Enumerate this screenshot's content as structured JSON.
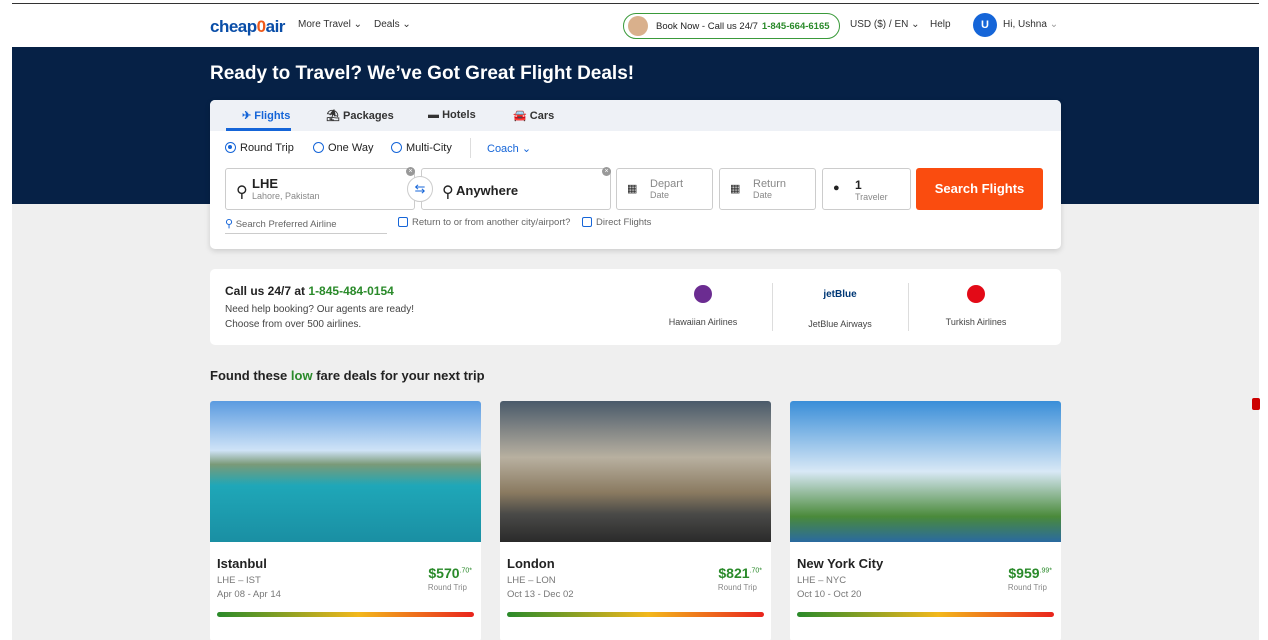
{
  "header": {
    "logo": "cheapOair",
    "more_travel": "More Travel",
    "deals": "Deals",
    "call_label": "Book Now - Call us 24/7",
    "call_phone": "1-845-664-6165",
    "currency": "USD ($) / EN",
    "help": "Help",
    "avatar_initial": "U",
    "greeting": "Hi, Ushna"
  },
  "hero": {
    "title": "Ready to Travel? We’ve Got Great Flight Deals!"
  },
  "search": {
    "tabs": [
      {
        "label": "Flights",
        "icon": "plane-icon"
      },
      {
        "label": "Packages",
        "icon": "beach-icon"
      },
      {
        "label": "Hotels",
        "icon": "bed-icon"
      },
      {
        "label": "Cars",
        "icon": "car-icon"
      }
    ],
    "trip_types": [
      {
        "label": "Round Trip",
        "selected": true
      },
      {
        "label": "One Way",
        "selected": false
      },
      {
        "label": "Multi-City",
        "selected": false
      }
    ],
    "cabin": "Coach",
    "from": {
      "code": "LHE",
      "city": "Lahore, Pakistan"
    },
    "to": {
      "value": "Anywhere"
    },
    "depart": {
      "label": "Depart",
      "sub": "Date"
    },
    "return": {
      "label": "Return",
      "sub": "Date"
    },
    "travelers": {
      "count": "1",
      "label": "Traveler"
    },
    "button": "Search Flights",
    "airline_placeholder": "Search Preferred Airline",
    "return_other": "Return to or from another city/airport?",
    "direct": "Direct Flights"
  },
  "info": {
    "call_prefix": "Call us 24/7 at",
    "phone": "1-845-484-0154",
    "line1": "Need help booking? Our agents are ready!",
    "line2": "Choose from over 500 airlines.",
    "airlines": [
      "Hawaiian Airlines",
      "JetBlue Airways",
      "Turkish Airlines"
    ],
    "jetblue_logo": "jetBlue"
  },
  "deals": {
    "pre": "Found these",
    "low": "low",
    "post": "fare deals for your next trip",
    "cards": [
      {
        "city": "Istanbul",
        "route": "LHE – IST",
        "dates": "Apr 08 - Apr 14",
        "price": "$570",
        "cents": ".70",
        "star": "*",
        "type": "Round Trip"
      },
      {
        "city": "London",
        "route": "LHE – LON",
        "dates": "Oct 13 - Dec 02",
        "price": "$821",
        "cents": ".70",
        "star": "*",
        "type": "Round Trip"
      },
      {
        "city": "New York City",
        "route": "LHE – NYC",
        "dates": "Oct 10 - Oct 20",
        "price": "$959",
        "cents": ".99",
        "star": "*",
        "type": "Round Trip"
      }
    ]
  },
  "colors": {
    "navy": "#062146",
    "accent": "#1565d8",
    "cta": "#fa4c0f",
    "green": "#2a8a2a"
  }
}
